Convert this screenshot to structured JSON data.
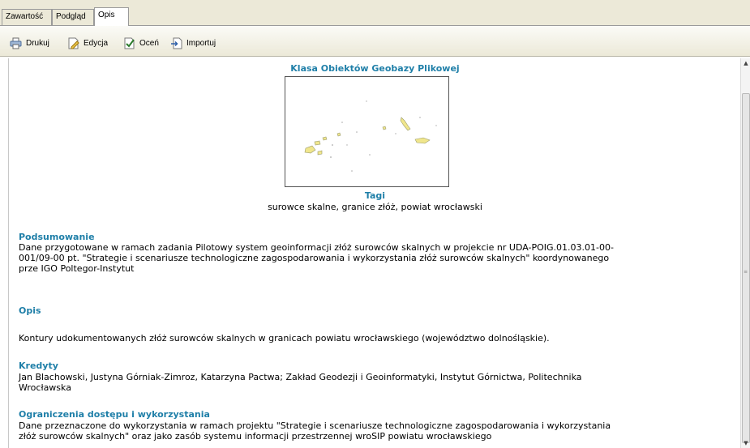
{
  "tabs": [
    {
      "label": "Zawartość"
    },
    {
      "label": "Podgląd"
    },
    {
      "label": "Opis"
    }
  ],
  "toolbar": {
    "print_label": "Drukuj",
    "edit_label": "Edycja",
    "rate_label": "Oceń",
    "import_label": "Importuj"
  },
  "doc": {
    "title": "Klasa Obiektów Geobazy Plikowej",
    "tags_heading": "Tagi",
    "tags": "surowce skalne, granice złóż, powiat wrocławski",
    "summary_heading": "Podsumowanie",
    "summary_lines": [
      "Dane przygotowane w ramach zadania Pilotowy system geoinformacji złóż surowców skalnych w projekcie nr UDA-POIG.01.03.01-00-",
      "001/09-00 pt. \"Strategie i scenariusze technologiczne zagospodarowania i wykorzystania złóż surowców skalnych\" koordynowanego",
      "prze IGO Poltegor-Instytut"
    ],
    "description_heading": "Opis",
    "description": "Kontury udokumentowanych złóż surowców skalnych w granicach powiatu wrocławskiego (województwo dolnośląskie).",
    "credits_heading": "Kredyty",
    "credits_lines": [
      "Jan Blachowski, Justyna Górniak-Zimroz, Katarzyna Pactwa; Zakład Geodezji i Geoinformatyki, Instytut Górnictwa, Politechnika",
      "Wrocławska"
    ],
    "restrictions_heading": "Ograniczenia dostępu i wykorzystania",
    "restrictions_lines": [
      "Dane przeznaczone do wykorzystania w ramach projektu \"Strategie i scenariusze technologiczne zagospodarowania i wykorzystania",
      "złóż surowców skalnych\" oraz jako zasób systemu informacji przestrzennej wroSIP powiatu wrocławskiego"
    ]
  },
  "icons": {
    "print": "printer-icon",
    "edit": "edit-icon",
    "rate": "rate-icon",
    "import": "import-icon"
  },
  "colors": {
    "heading": "#1f7fa8",
    "deposit_fill": "#f0e68c"
  }
}
